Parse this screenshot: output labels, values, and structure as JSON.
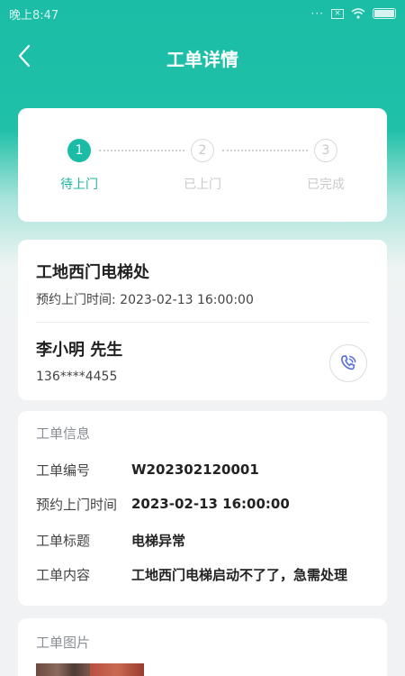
{
  "status_bar": {
    "time": "晚上8:47",
    "signal_dots": "···"
  },
  "nav": {
    "title": "工单详情"
  },
  "steps": [
    {
      "number": "1",
      "label": "待上门",
      "state": "active"
    },
    {
      "number": "2",
      "label": "已上门",
      "state": "inactive"
    },
    {
      "number": "3",
      "label": "已完成",
      "state": "inactive"
    }
  ],
  "contact": {
    "site_name": "工地西门电梯处",
    "appointment": "预约上门时间: 2023-02-13 16:00:00",
    "person_name": "李小明 先生",
    "phone": "136****4455"
  },
  "work_order": {
    "section_title": "工单信息",
    "rows": [
      {
        "key": "工单编号",
        "value": "W202302120001"
      },
      {
        "key": "预约上门时间",
        "value": "2023-02-13 16:00:00"
      },
      {
        "key": "工单标题",
        "value": "电梯异常"
      },
      {
        "key": "工单内容",
        "value": "工地西门电梯启动不了了，急需处理"
      }
    ]
  },
  "photos": {
    "section_title": "工单图片"
  },
  "colors": {
    "accent": "#1bbca5",
    "call_icon": "#5b6fd8"
  }
}
